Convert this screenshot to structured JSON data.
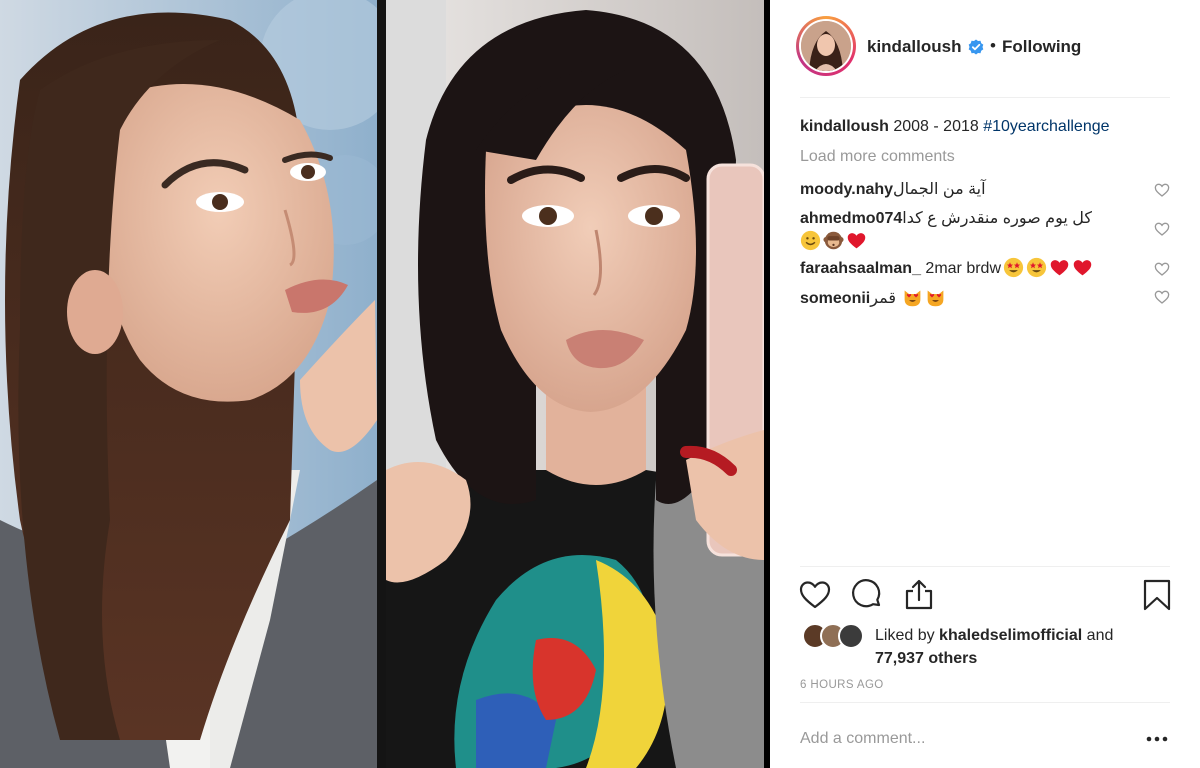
{
  "post_image": {
    "left_panel": "woman-2008-photo",
    "right_panel": "woman-2018-selfie"
  },
  "header": {
    "username": "kindalloush",
    "verified": true,
    "separator": "•",
    "follow_state": "Following"
  },
  "caption": {
    "username": "kindalloush",
    "text": " 2008 - 2018 ",
    "hashtag": "#10yearchallenge"
  },
  "load_more": "Load more comments",
  "comments": [
    {
      "username": "moody.nahy",
      "text": " آية من الجمال",
      "emojis": []
    },
    {
      "username": "ahmedmo074",
      "text": " كل يوم صوره منقدرش ع كدا ",
      "emojis": [
        "face-with-smile-emoji",
        "see-no-evil-monkey-emoji",
        "red-heart-emoji"
      ]
    },
    {
      "username": "faraahsaalman_",
      "text": " 2mar brdw",
      "emojis": [
        "star-struck-emoji",
        "star-struck-emoji",
        "red-heart-emoji",
        "red-heart-emoji"
      ]
    },
    {
      "username": "someonii",
      "text": " قمر",
      "emojis": [
        "heart-eyes-cat-emoji",
        "heart-eyes-cat-emoji"
      ]
    }
  ],
  "likes": {
    "prefix": "Liked by ",
    "user": "khaledselimofficial",
    "joiner": " and",
    "count": "77,937 others"
  },
  "timestamp": "6 HOURS AGO",
  "add_comment": {
    "placeholder": "Add a comment..."
  },
  "icons": {
    "like": "heart-outline-icon",
    "comment": "speech-bubble-icon",
    "share": "share-upload-icon",
    "save": "bookmark-icon",
    "more": "three-dots-icon",
    "verified": "verified-badge-icon"
  },
  "colors": {
    "text": "#262626",
    "muted": "#999999",
    "hashtag": "#003569",
    "verified": "#3897f0",
    "divider": "#efefef"
  }
}
